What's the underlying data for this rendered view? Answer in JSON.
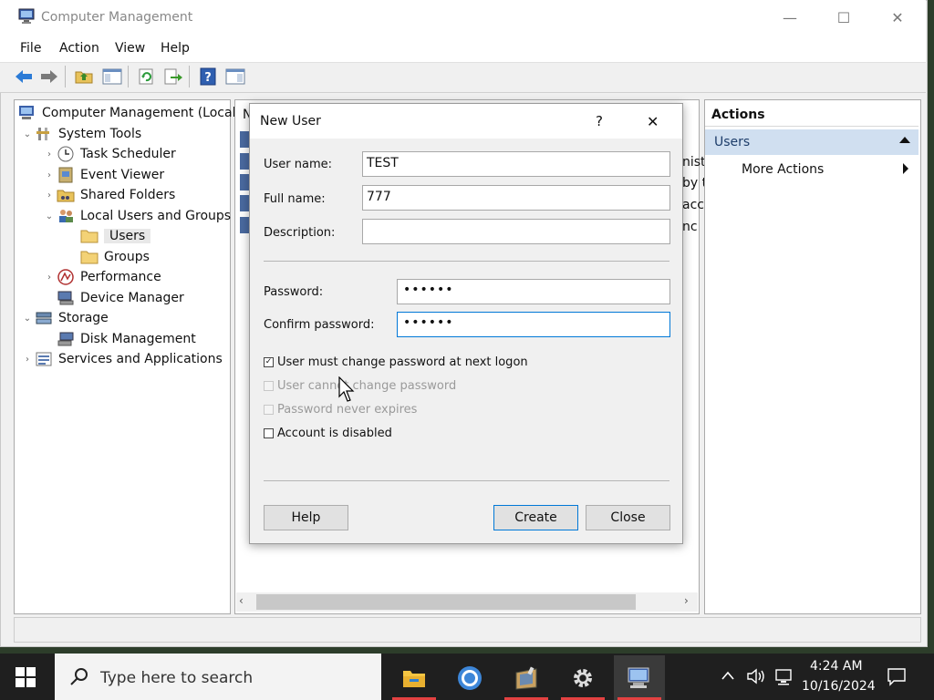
{
  "window": {
    "title": "Computer Management",
    "min": "—",
    "max": "☐",
    "close": "✕"
  },
  "menu": [
    "File",
    "Action",
    "View",
    "Help"
  ],
  "tree": {
    "root": "Computer Management (Local)",
    "system_tools": "System Tools",
    "task_scheduler": "Task Scheduler",
    "event_viewer": "Event Viewer",
    "shared_folders": "Shared Folders",
    "local_users_groups": "Local Users and Groups",
    "users": "Users",
    "groups": "Groups",
    "performance": "Performance",
    "device_manager": "Device Manager",
    "storage": "Storage",
    "disk_management": "Disk Management",
    "services_apps": "Services and Applications"
  },
  "middle": {
    "header_fragment": "N",
    "peek_lines": [
      "nist",
      "by t",
      "acc",
      "nc"
    ]
  },
  "actions": {
    "header": "Actions",
    "section": "Users",
    "more": "More Actions"
  },
  "dialog": {
    "title": "New User",
    "help_glyph": "?",
    "close_glyph": "✕",
    "username_label": "User name:",
    "username_value": "TEST",
    "fullname_label": "Full name:",
    "fullname_value": "777",
    "description_label": "Description:",
    "description_value": "",
    "password_label": "Password:",
    "password_value": "••••••",
    "confirm_label": "Confirm password:",
    "confirm_value": "••••••",
    "chk_must_change": "User must change password at next logon",
    "chk_cannot_change": "User cannot change password",
    "chk_never_expires": "Password never expires",
    "chk_disabled": "Account is disabled",
    "help_button": "Help",
    "create_button": "Create",
    "close_button": "Close"
  },
  "taskbar": {
    "search_placeholder": "Type here to search",
    "time": "4:24 AM",
    "date": "10/16/2024"
  },
  "colors": {
    "accent": "#0078d7",
    "selection": "#d0dff0",
    "taskbar": "#1f1f1f",
    "indicator": "#e34141"
  }
}
